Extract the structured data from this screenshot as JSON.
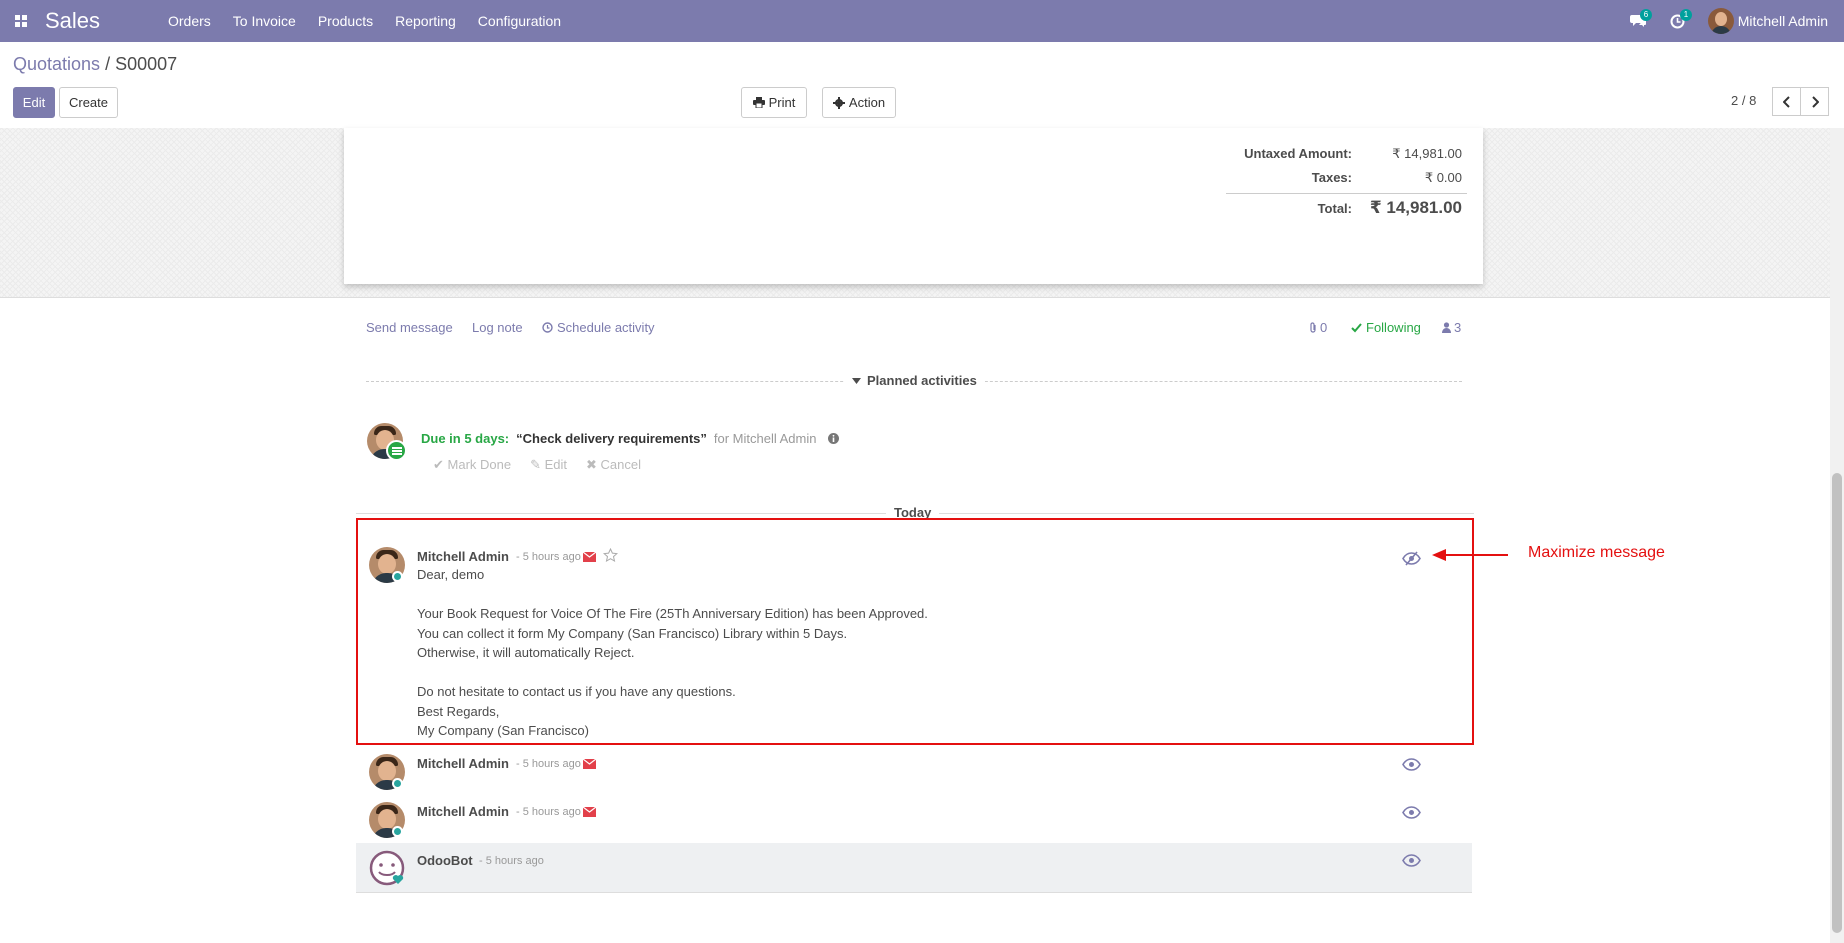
{
  "navbar": {
    "app_name": "Sales",
    "menu": [
      "Orders",
      "To Invoice",
      "Products",
      "Reporting",
      "Configuration"
    ],
    "messages_badge": "6",
    "activities_badge": "1",
    "user_name": "Mitchell Admin"
  },
  "control": {
    "breadcrumb_parent": "Quotations",
    "breadcrumb_sep": " / ",
    "breadcrumb_current": "S00007",
    "edit_label": "Edit",
    "create_label": "Create",
    "print_label": "Print",
    "action_label": "Action",
    "pager": "2 / 8"
  },
  "totals": {
    "untaxed_label": "Untaxed Amount:",
    "untaxed_value": "₹ 14,981.00",
    "taxes_label": "Taxes:",
    "taxes_value": "₹ 0.00",
    "total_label": "Total:",
    "total_value": "₹ 14,981.00"
  },
  "chatter": {
    "send_message": "Send message",
    "log_note": "Log note",
    "schedule_activity": "Schedule activity",
    "attachments": "0",
    "following": "Following",
    "followers": "3",
    "planned_title": "Planned activities",
    "activity_due": "Due in 5 days:",
    "activity_title": "“Check delivery requirements”",
    "activity_for": "for Mitchell Admin",
    "mark_done": "Mark Done",
    "edit": "Edit",
    "cancel": "Cancel",
    "today": "Today",
    "messages": [
      {
        "author": "Mitchell Admin",
        "date": "- 5 hours ago",
        "lines": [
          "Dear, demo",
          "",
          "Your Book Request for Voice Of The Fire (25Th Anniversary Edition) has been Approved.",
          "You can collect it form My Company (San Francisco) Library within 5 Days.",
          "Otherwise, it will automatically Reject.",
          "",
          "Do not hesitate to contact us if you have any questions.",
          "Best Regards,",
          "My Company (San Francisco)"
        ]
      },
      {
        "author": "Mitchell Admin",
        "date": "- 5 hours ago"
      },
      {
        "author": "Mitchell Admin",
        "date": "- 5 hours ago"
      },
      {
        "author": "OdooBot",
        "date": "- 5 hours ago"
      }
    ]
  },
  "annotation": {
    "text": "Maximize message",
    "color": "#e41010"
  },
  "colors": {
    "brand": "#7c7bad",
    "success": "#28a745",
    "danger": "#e2404a"
  }
}
